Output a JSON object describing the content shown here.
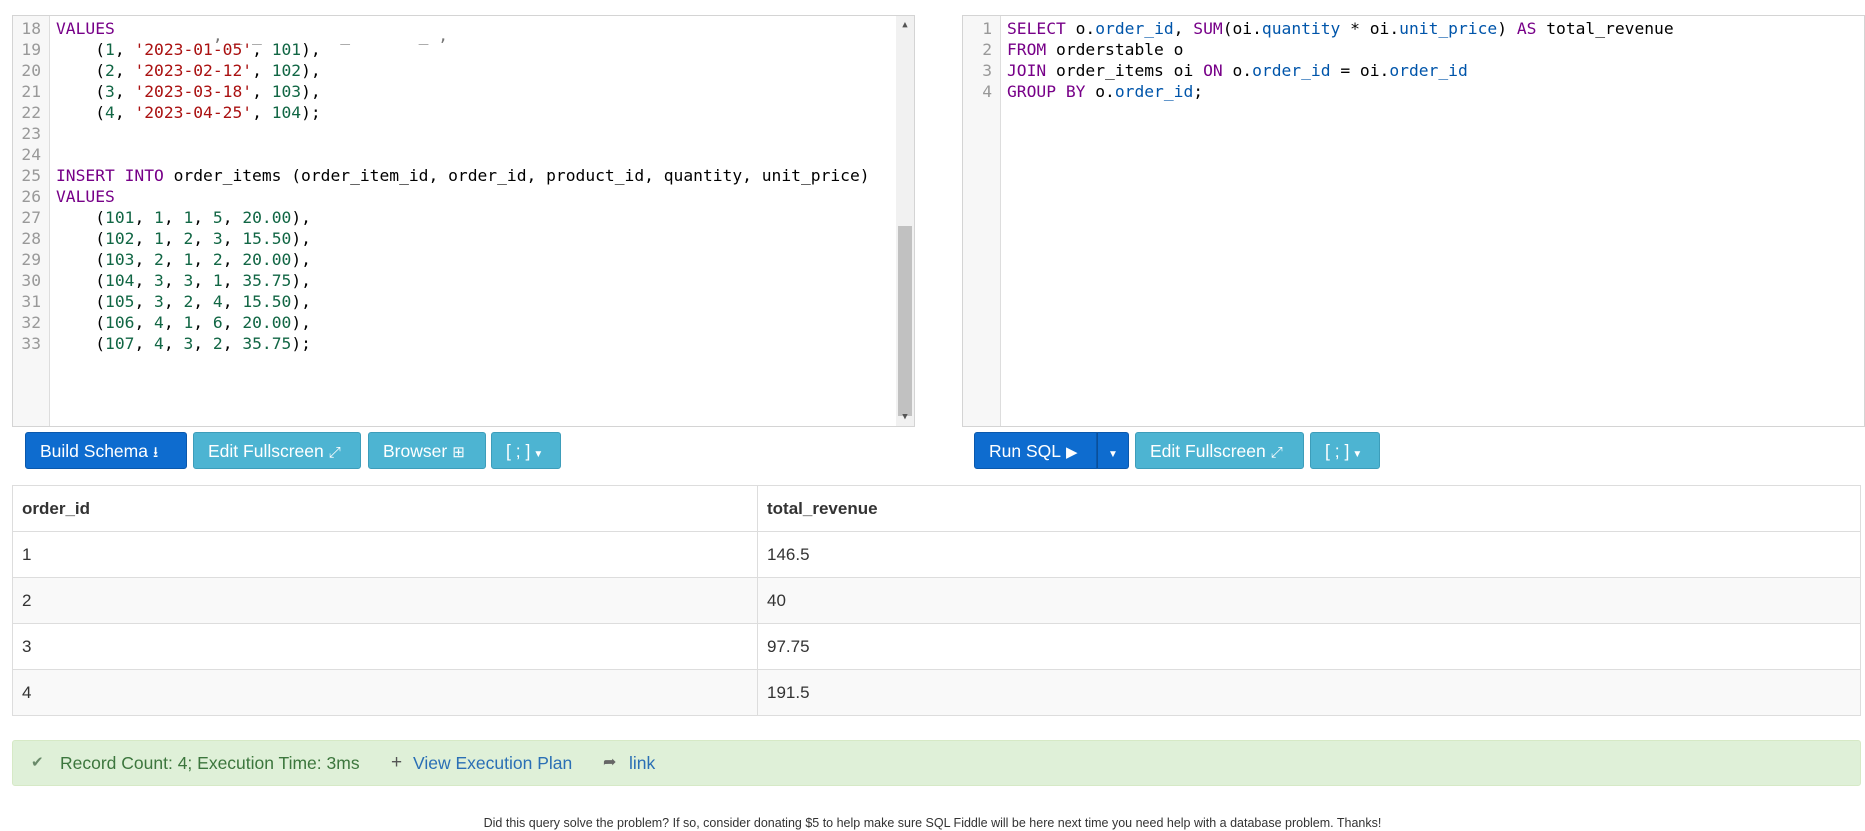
{
  "schema_editor": {
    "partial_top_line": "                , _ _        _       _ ,",
    "lines": [
      {
        "n": "18",
        "html": "<span class=\"kw\">VALUES</span>"
      },
      {
        "n": "19",
        "html": "    (<span class=\"num\">1</span>, <span class=\"str\">'2023-01-05'</span>, <span class=\"num\">101</span>),"
      },
      {
        "n": "20",
        "html": "    (<span class=\"num\">2</span>, <span class=\"str\">'2023-02-12'</span>, <span class=\"num\">102</span>),"
      },
      {
        "n": "21",
        "html": "    (<span class=\"num\">3</span>, <span class=\"str\">'2023-03-18'</span>, <span class=\"num\">103</span>),"
      },
      {
        "n": "22",
        "html": "    (<span class=\"num\">4</span>, <span class=\"str\">'2023-04-25'</span>, <span class=\"num\">104</span>);"
      },
      {
        "n": "23",
        "html": ""
      },
      {
        "n": "24",
        "html": ""
      },
      {
        "n": "25",
        "html": "<span class=\"kw\">INSERT INTO</span> order_items (order_item_id, order_id, product_id, quantity, unit_price)"
      },
      {
        "n": "26",
        "html": "<span class=\"kw\">VALUES</span>"
      },
      {
        "n": "27",
        "html": "    (<span class=\"num\">101</span>, <span class=\"num\">1</span>, <span class=\"num\">1</span>, <span class=\"num\">5</span>, <span class=\"num\">20.00</span>),"
      },
      {
        "n": "28",
        "html": "    (<span class=\"num\">102</span>, <span class=\"num\">1</span>, <span class=\"num\">2</span>, <span class=\"num\">3</span>, <span class=\"num\">15.50</span>),"
      },
      {
        "n": "29",
        "html": "    (<span class=\"num\">103</span>, <span class=\"num\">2</span>, <span class=\"num\">1</span>, <span class=\"num\">2</span>, <span class=\"num\">20.00</span>),"
      },
      {
        "n": "30",
        "html": "    (<span class=\"num\">104</span>, <span class=\"num\">3</span>, <span class=\"num\">3</span>, <span class=\"num\">1</span>, <span class=\"num\">35.75</span>),"
      },
      {
        "n": "31",
        "html": "    (<span class=\"num\">105</span>, <span class=\"num\">3</span>, <span class=\"num\">2</span>, <span class=\"num\">4</span>, <span class=\"num\">15.50</span>),"
      },
      {
        "n": "32",
        "html": "    (<span class=\"num\">106</span>, <span class=\"num\">4</span>, <span class=\"num\">1</span>, <span class=\"num\">6</span>, <span class=\"num\">20.00</span>),"
      },
      {
        "n": "33",
        "html": "    (<span class=\"num\">107</span>, <span class=\"num\">4</span>, <span class=\"num\">3</span>, <span class=\"num\">2</span>, <span class=\"num\">35.75</span>);"
      }
    ]
  },
  "query_editor": {
    "lines": [
      {
        "n": "1",
        "html": "<span class=\"kw\">SELECT</span> o.<span class=\"prop\">order_id</span>, <span class=\"kw\">SUM</span>(oi.<span class=\"prop\">quantity</span> * oi.<span class=\"prop\">unit_price</span>) <span class=\"kw\">AS</span> total_revenue"
      },
      {
        "n": "2",
        "html": "<span class=\"kw\">FROM</span> orderstable o"
      },
      {
        "n": "3",
        "html": "<span class=\"kw\">JOIN</span> order_items oi <span class=\"kw\">ON</span> o.<span class=\"prop\">order_id</span> = oi.<span class=\"prop\">order_id</span>"
      },
      {
        "n": "4",
        "html": "<span class=\"kw\">GROUP BY</span> o.<span class=\"prop\">order_id</span>;"
      }
    ]
  },
  "schema_toolbar": {
    "build_schema": "Build Schema",
    "edit_fullscreen": "Edit Fullscreen",
    "browser": "Browser",
    "delimiter": "[ ; ]"
  },
  "query_toolbar": {
    "run_sql": "Run SQL",
    "edit_fullscreen": "Edit Fullscreen",
    "delimiter": "[ ; ]"
  },
  "results": {
    "columns": [
      "order_id",
      "total_revenue"
    ],
    "rows": [
      [
        "1",
        "146.5"
      ],
      [
        "2",
        "40"
      ],
      [
        "3",
        "97.75"
      ],
      [
        "4",
        "191.5"
      ]
    ]
  },
  "status": {
    "record_info": "Record Count: 4; Execution Time: 3ms",
    "execution_plan": "View Execution Plan",
    "link": "link"
  },
  "footer": "Did this query solve the problem? If so, consider donating $5 to help make sure SQL Fiddle will be here next time you need help with a database problem. Thanks!",
  "colors": {
    "primary_button": "#0e6ccf",
    "info_button": "#4db4d2",
    "success_bg": "#dff0d8",
    "keyword": "#770088",
    "number": "#116644",
    "string": "#aa1111",
    "property": "#0055aa"
  }
}
